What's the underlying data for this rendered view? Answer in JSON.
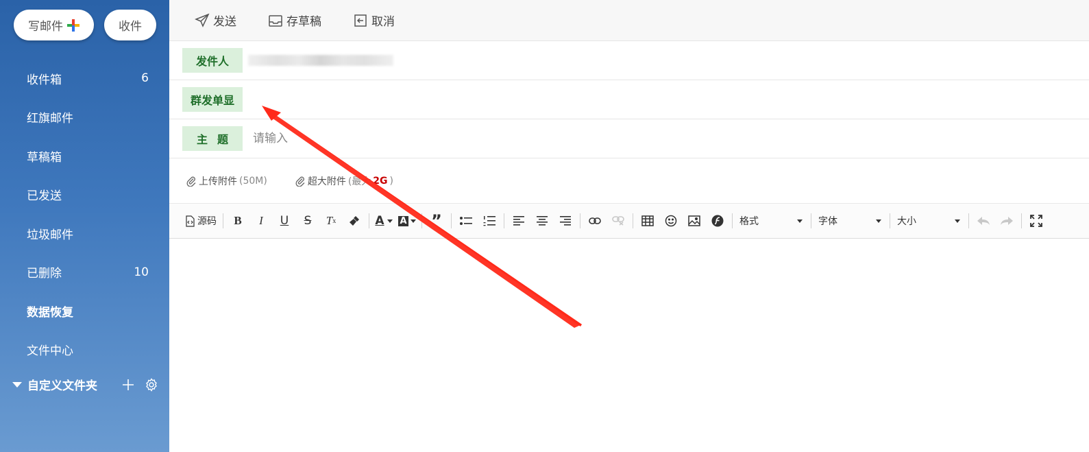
{
  "sidebar": {
    "compose_label": "写邮件",
    "receive_label": "收件",
    "items": [
      {
        "label": "收件箱",
        "count": "6",
        "bold": false
      },
      {
        "label": "红旗邮件",
        "count": "",
        "bold": false
      },
      {
        "label": "草稿箱",
        "count": "",
        "bold": false
      },
      {
        "label": "已发送",
        "count": "",
        "bold": false
      },
      {
        "label": "垃圾邮件",
        "count": "",
        "bold": false
      },
      {
        "label": "已删除",
        "count": "10",
        "bold": false
      },
      {
        "label": "数据恢复",
        "count": "",
        "bold": true
      },
      {
        "label": "文件中心",
        "count": "",
        "bold": false
      }
    ],
    "custom_folder_label": "自定义文件夹"
  },
  "toolbar": {
    "send_label": "发送",
    "draft_label": "存草稿",
    "cancel_label": "取消"
  },
  "fields": {
    "sender_label": "发件人",
    "mass_label": "群发单显",
    "subject_label": "主题",
    "subject_placeholder": "请输入"
  },
  "attachments": {
    "upload_label": "上传附件",
    "upload_limit": "(50M)",
    "large_label": "超大附件",
    "large_prefix": "(最大",
    "large_size": "2G",
    "large_suffix": ")"
  },
  "editor": {
    "source_label": "源码",
    "format_label": "格式",
    "font_label": "字体",
    "size_label": "大小"
  },
  "colors": {
    "sidebar_top": "#2a62a8",
    "sidebar_bottom": "#6a9bd1",
    "field_tag_bg": "#dbf0dc",
    "field_tag_text": "#1f6f2a",
    "annotation_arrow": "#ff2a1a"
  }
}
